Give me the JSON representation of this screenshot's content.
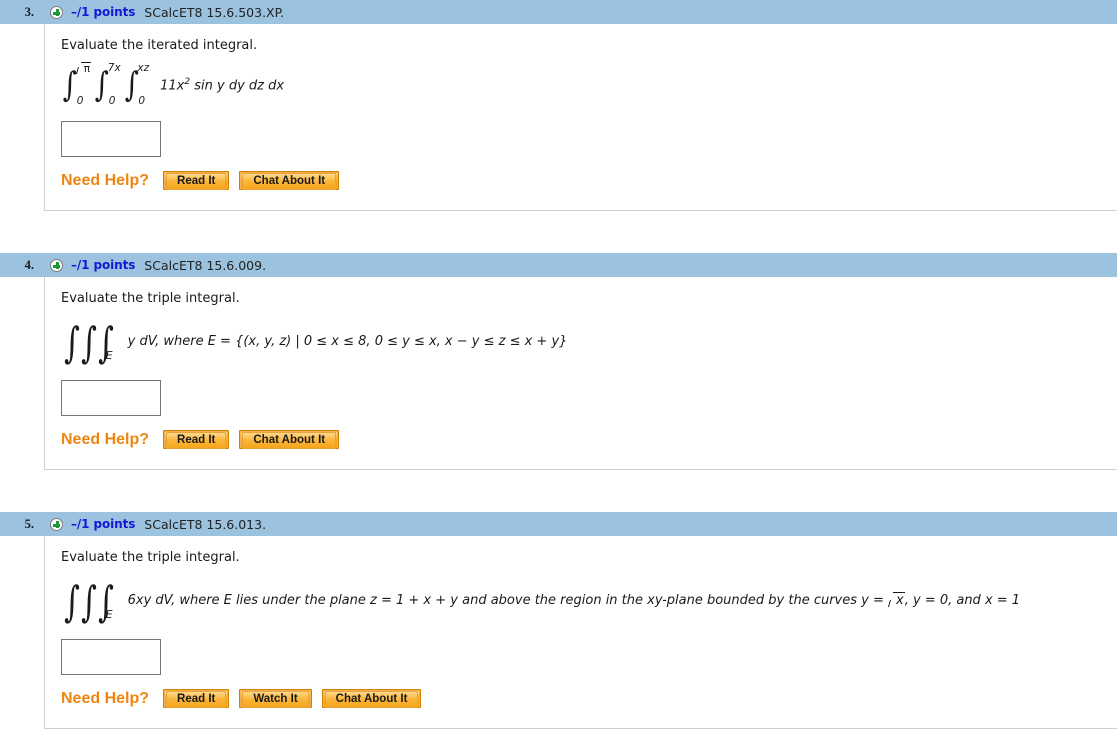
{
  "questions": [
    {
      "number": "3.",
      "plus_icon": "plus-circle-icon",
      "points": "–/1 points",
      "code": "SCalcET8 15.6.503.XP.",
      "prompt": "Evaluate the iterated integral.",
      "math": {
        "type": "iterated-integral",
        "limits": [
          {
            "upper": "√π",
            "upper_radicand": "π",
            "lower": "0"
          },
          {
            "upper": "7x",
            "lower": "0"
          },
          {
            "upper": "xz",
            "lower": "0"
          }
        ],
        "integrand_pre": "11x",
        "integrand_exp": "2",
        "integrand_post": "sin y dy dz dx"
      },
      "answer_value": "",
      "answer_placeholder": "",
      "need_help_label": "Need Help?",
      "help_buttons": [
        "Read It",
        "Chat About It"
      ]
    },
    {
      "number": "4.",
      "plus_icon": "plus-circle-icon",
      "points": "–/1 points",
      "code": "SCalcET8 15.6.009.",
      "prompt": "Evaluate the triple integral.",
      "math": {
        "type": "triple-integral",
        "subscript": "E",
        "text": "y dV, where E = {(x, y, z) | 0 ≤ x ≤ 8, 0 ≤ y ≤ x, x − y ≤ z ≤ x + y}"
      },
      "answer_value": "",
      "answer_placeholder": "",
      "need_help_label": "Need Help?",
      "help_buttons": [
        "Read It",
        "Chat About It"
      ]
    },
    {
      "number": "5.",
      "plus_icon": "plus-circle-icon",
      "points": "–/1 points",
      "code": "SCalcET8 15.6.013.",
      "prompt": "Evaluate the triple integral.",
      "math": {
        "type": "triple-integral",
        "subscript": "E",
        "text_a": "6xy dV, where E lies under the plane z = 1 + x + y and above the region in the xy-plane bounded by the curves y = ",
        "radicand": "x",
        "text_b": ", y = 0, and x = 1"
      },
      "answer_value": "",
      "answer_placeholder": "",
      "need_help_label": "Need Help?",
      "help_buttons": [
        "Read It",
        "Watch It",
        "Chat About It"
      ]
    }
  ],
  "colors": {
    "header_blue": "#9bc3e0",
    "points_blue": "#1318d6",
    "need_help_orange": "#ef8511",
    "button_orange": "#f5a623",
    "plus_green": "#1a9a32",
    "border_gray": "#cfcfcf"
  }
}
